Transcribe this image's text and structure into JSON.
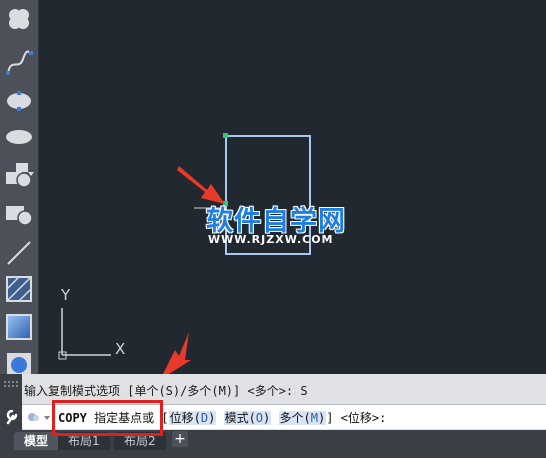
{
  "tools": [
    {
      "name": "cloud-shape-icon"
    },
    {
      "name": "spline-icon"
    },
    {
      "name": "ellipse-icon"
    },
    {
      "name": "ellipse-filled-icon"
    },
    {
      "name": "block-insert-icon"
    },
    {
      "name": "make-block-icon"
    },
    {
      "name": "line-icon"
    },
    {
      "name": "hatch-icon"
    },
    {
      "name": "gradient-icon"
    },
    {
      "name": "region-icon"
    }
  ],
  "ucs": {
    "y_label": "Y",
    "x_label": "X"
  },
  "command": {
    "history": "输入复制模式选项 [单个(S)/多个(M)] <多个>: S",
    "cmd_name": "COPY",
    "prompt_text": "指定基点或",
    "open_bracket": "[",
    "opt1_label": "位移(",
    "opt1_key": "D",
    "opt1_close": ")",
    "opt2_label": "模式(",
    "opt2_key": "O",
    "opt2_close": ")",
    "opt3_label": "多个(",
    "opt3_key": "M",
    "opt3_close": ")",
    "close_bracket": "]",
    "default": "<位移>:"
  },
  "tabs": {
    "model": "模型",
    "layout1": "布局1",
    "layout2": "布局2",
    "add": "+"
  },
  "watermark": {
    "title": "软件自学网",
    "url": "WWW.RJZXW.COM"
  },
  "colors": {
    "canvas": "#212830",
    "rectangle": "#a8c8f0",
    "accent_arrow": "#e83a2a",
    "highlight": "#e02020"
  }
}
